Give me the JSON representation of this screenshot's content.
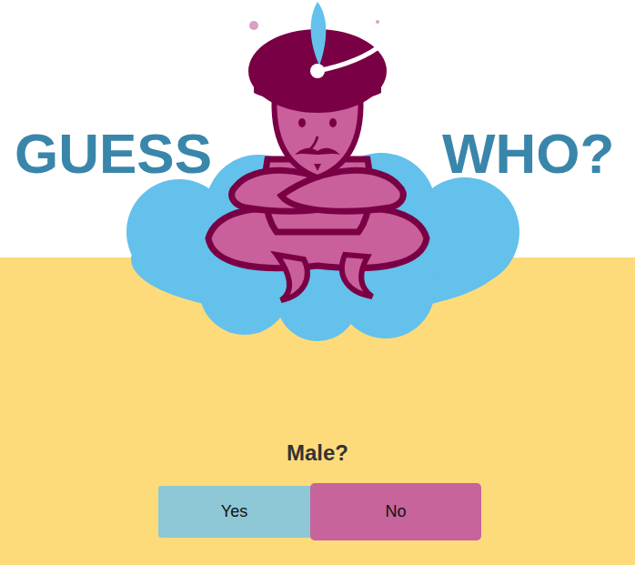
{
  "title": {
    "left": "GUESS",
    "right": "WHO?"
  },
  "question": "Male?",
  "answers": [
    {
      "label": "Yes",
      "hovered": false
    },
    {
      "label": "No",
      "hovered": true
    }
  ]
}
